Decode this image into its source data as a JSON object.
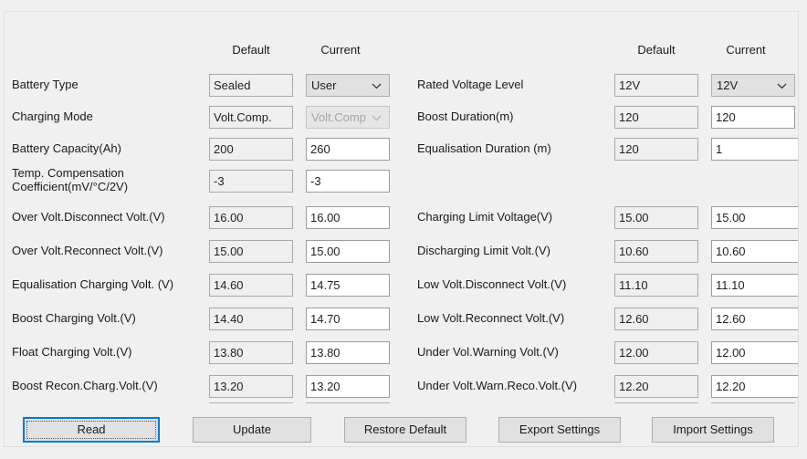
{
  "window": {
    "background_color": "#f0f0f0",
    "accent_color": "#0078d7"
  },
  "columns": {
    "left": {
      "default_header": "Default",
      "current_header": "Current"
    },
    "right": {
      "default_header": "Default",
      "current_header": "Current"
    }
  },
  "left_rows": [
    {
      "label": "Battery Type",
      "default_value": "Sealed",
      "current_value": "User",
      "current_type": "combo",
      "current_enabled": true
    },
    {
      "label": "Charging Mode",
      "default_value": "Volt.Comp.",
      "current_value": "Volt.Comp",
      "current_type": "combo",
      "current_enabled": false
    },
    {
      "label": "Battery Capacity(Ah)",
      "default_value": "200",
      "current_value": "260",
      "current_type": "text",
      "current_enabled": true
    },
    {
      "label": "Temp. Compensation\nCoefficient(mV/°C/2V)",
      "default_value": "-3",
      "current_value": "-3",
      "current_type": "text",
      "current_enabled": true,
      "two_line": true
    },
    {
      "label": "Over Volt.Disconnect Volt.(V)",
      "default_value": "16.00",
      "current_value": "16.00",
      "current_type": "text",
      "current_enabled": true
    },
    {
      "label": "Over Volt.Reconnect Volt.(V)",
      "default_value": "15.00",
      "current_value": "15.00",
      "current_type": "text",
      "current_enabled": true
    },
    {
      "label": "Equalisation Charging Volt. (V)",
      "default_value": "14.60",
      "current_value": "14.75",
      "current_type": "text",
      "current_enabled": true
    },
    {
      "label": "Boost Charging Volt.(V)",
      "default_value": "14.40",
      "current_value": "14.70",
      "current_type": "text",
      "current_enabled": true
    },
    {
      "label": "Float Charging Volt.(V)",
      "default_value": "13.80",
      "current_value": "13.80",
      "current_type": "text",
      "current_enabled": true
    },
    {
      "label": "Boost Recon.Charg.Volt.(V)",
      "default_value": "13.20",
      "current_value": "13.20",
      "current_type": "text",
      "current_enabled": true
    }
  ],
  "right_rows": [
    {
      "label": "Rated Voltage Level",
      "default_value": "12V",
      "current_value": "12V",
      "current_type": "combo",
      "current_enabled": true
    },
    {
      "label": "Boost Duration(m)",
      "default_value": "120",
      "current_value": "120",
      "current_type": "text",
      "current_enabled": true
    },
    {
      "label": "Equalisation Duration (m)",
      "default_value": "120",
      "current_value": "1",
      "current_type": "text",
      "current_enabled": true
    },
    {
      "label": "Charging Limit Voltage(V)",
      "default_value": "15.00",
      "current_value": "15.00",
      "current_type": "text",
      "current_enabled": true
    },
    {
      "label": "Discharging Limit Volt.(V)",
      "default_value": "10.60",
      "current_value": "10.60",
      "current_type": "text",
      "current_enabled": true
    },
    {
      "label": "Low Volt.Disconnect Volt.(V)",
      "default_value": "11.10",
      "current_value": "11.10",
      "current_type": "text",
      "current_enabled": true
    },
    {
      "label": "Low Volt.Reconnect Volt.(V)",
      "default_value": "12.60",
      "current_value": "12.60",
      "current_type": "text",
      "current_enabled": true
    },
    {
      "label": "Under Vol.Warning Volt.(V)",
      "default_value": "12.00",
      "current_value": "12.00",
      "current_type": "text",
      "current_enabled": true
    },
    {
      "label": "Under Volt.Warn.Reco.Volt.(V)",
      "default_value": "12.20",
      "current_value": "12.20",
      "current_type": "text",
      "current_enabled": true
    }
  ],
  "buttons": [
    {
      "label": "Read",
      "focused": true
    },
    {
      "label": "Update",
      "focused": false
    },
    {
      "label": "Restore Default",
      "focused": false
    },
    {
      "label": "Export Settings",
      "focused": false
    },
    {
      "label": "Import Settings",
      "focused": false
    }
  ],
  "icons": {
    "chevron_down": "chevron-down-icon"
  }
}
